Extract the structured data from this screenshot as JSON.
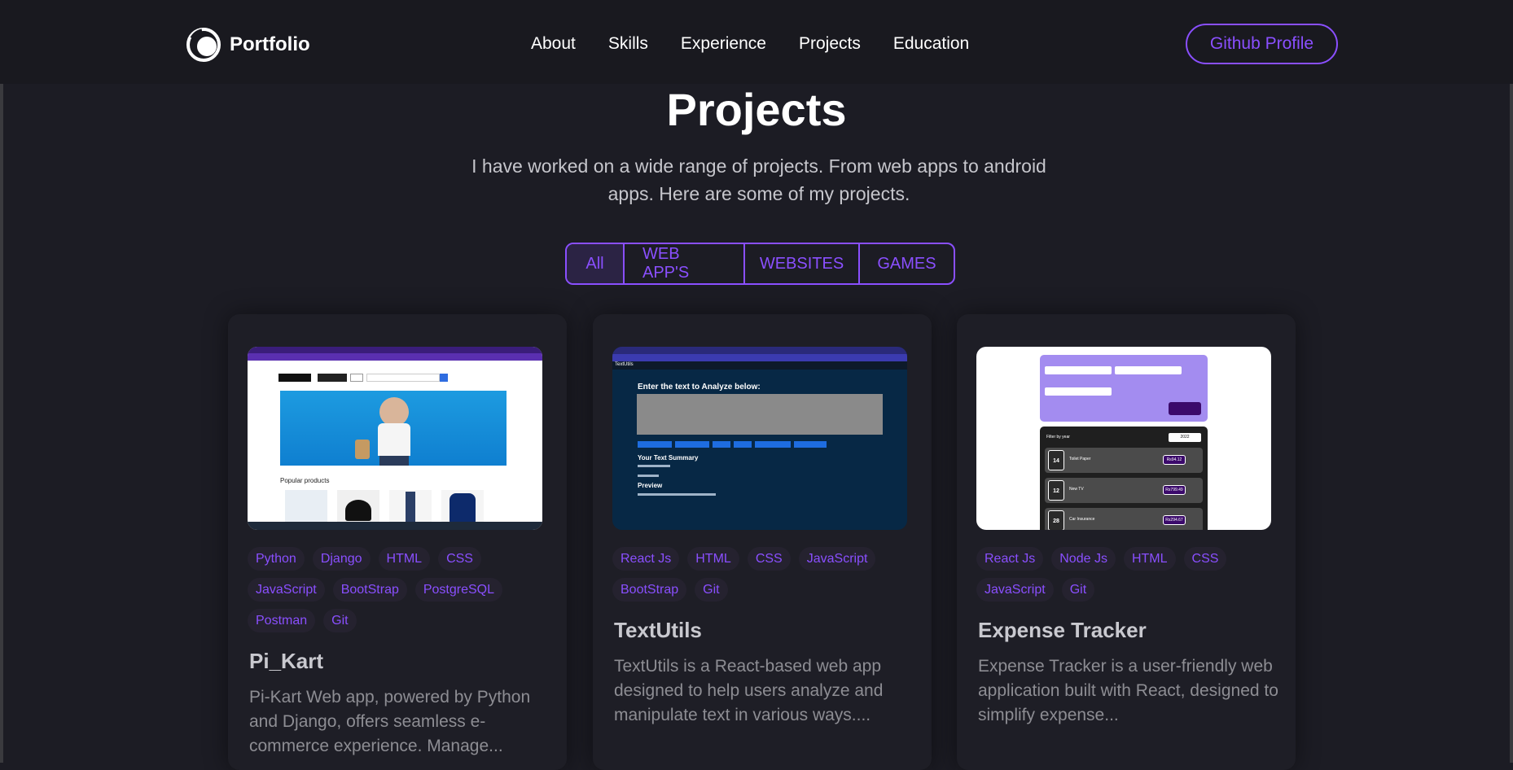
{
  "nav": {
    "logo_text": "Portfolio",
    "links": [
      "About",
      "Skills",
      "Experience",
      "Projects",
      "Education"
    ],
    "github_label": "Github Profile"
  },
  "section": {
    "title": "Projects",
    "subtitle": "I have worked on a wide range of projects. From web apps to android apps. Here are some of my projects."
  },
  "filters": [
    "All",
    "WEB APP'S",
    "WEBSITES",
    "GAMES"
  ],
  "projects": [
    {
      "title": "Pi_Kart",
      "tags": [
        "Python",
        "Django",
        "HTML",
        "CSS",
        "JavaScript",
        "BootStrap",
        "PostgreSQL",
        "Postman",
        "Git"
      ],
      "description": "Pi-Kart Web app, powered by Python and Django, offers seamless e-commerce experience. Manage...",
      "thumb": {
        "section_label": "Popular products"
      }
    },
    {
      "title": "TextUtils",
      "tags": [
        "React Js",
        "HTML",
        "CSS",
        "JavaScript",
        "BootStrap",
        "Git"
      ],
      "description": "TextUtils is a React-based web app designed to help users analyze and manipulate text in various ways....",
      "thumb": {
        "brand": "TextUtils",
        "heading": "Enter the text to Analyze below:",
        "summary": "Your Text Summary",
        "preview": "Preview"
      }
    },
    {
      "title": "Expense Tracker",
      "tags": [
        "React Js",
        "Node Js",
        "HTML",
        "CSS",
        "JavaScript",
        "Git"
      ],
      "description": "Expense Tracker is a user-friendly web application built with React, designed to simplify expense...",
      "thumb": {
        "filter_label": "Filter by year",
        "year": "2022",
        "items": [
          {
            "day": "14",
            "name": "Toilet Paper",
            "amount": "Rs94.12"
          },
          {
            "day": "12",
            "name": "New TV",
            "amount": "Rs799.49"
          },
          {
            "day": "28",
            "name": "Car Insurance",
            "amount": "Rs294.67"
          }
        ]
      }
    }
  ],
  "colors": {
    "accent": "#8a4fff",
    "background": "#1c1c24",
    "nav": "#19191f"
  }
}
